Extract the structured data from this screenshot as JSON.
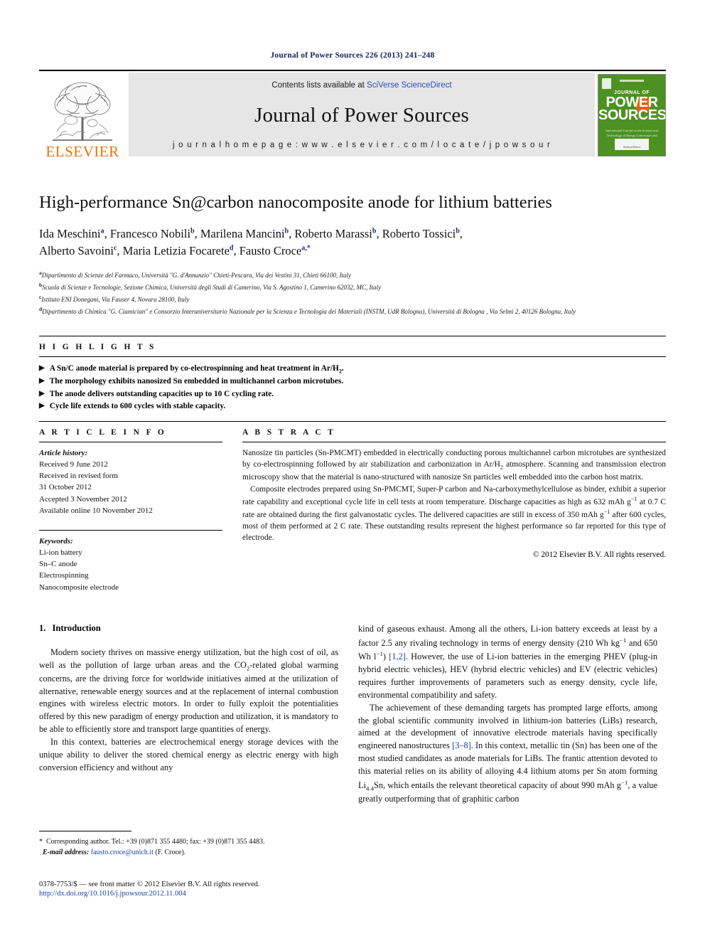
{
  "running_head": "Journal of Power Sources 226 (2013) 241–248",
  "masthead": {
    "publisher_name": "ELSEVIER",
    "banner_contents_prefix": "Contents lists available at ",
    "banner_contents_link": "SciVerse ScienceDirect",
    "journal_title": "Journal of Power Sources",
    "homepage": "j o u r n a l   h o m e p a g e :   w w w . e l s e v i e r . c o m / l o c a t e / j p o w s o u r",
    "cover": {
      "journal_of": "JOURNAL OF",
      "power": "POWER",
      "sources": "SOURCES",
      "subtitle": "International Journal on the Science and Technology of Energy Conversion and Electrochemical Systems",
      "footer_note": "Available online at",
      "footer_box": "ScienceDirect"
    },
    "colors": {
      "cover_green": "#4d9122",
      "cover_orange": "#e8600f",
      "elsevier_orange": "#e8730c",
      "link_blue": "#2a4bbd"
    }
  },
  "article": {
    "title": "High-performance Sn@carbon nanocomposite anode for lithium batteries",
    "authors_line1": "Ida Meschini ª, Francesco Nobili b, Marilena Mancini b, Roberto Marassi b, Roberto Tossici b,",
    "authors_line2": "Alberto Savoini c, Maria Letizia Focarete d, Fausto Croce a,*",
    "authors": [
      {
        "name": "Ida Meschini",
        "sup": "a"
      },
      {
        "name": "Francesco Nobili",
        "sup": "b"
      },
      {
        "name": "Marilena Mancini",
        "sup": "b"
      },
      {
        "name": "Roberto Marassi",
        "sup": "b"
      },
      {
        "name": "Roberto Tossici",
        "sup": "b"
      },
      {
        "name": "Alberto Savoini",
        "sup": "c"
      },
      {
        "name": "Maria Letizia Focarete",
        "sup": "d"
      },
      {
        "name": "Fausto Croce",
        "sup": "a,*"
      }
    ],
    "affiliations": [
      {
        "sup": "a",
        "text": "Dipartimento di Scienze del Farmaco, Università \"G. d'Annunzio\" Chieti-Pescara, Via dei Vestini 31, Chieti 66100, Italy"
      },
      {
        "sup": "b",
        "text": "Scuola di Scienze e Tecnologie, Sezione Chimica, Università degli Studi di Camerino, Via S. Agostino 1, Camerino 62032, MC, Italy"
      },
      {
        "sup": "c",
        "text": "Istituto ENI Donegani, Via Fauser 4, Novara 28100, Italy"
      },
      {
        "sup": "d",
        "text": "Dipartimento di Chimica \"G. Ciamician\" e Consorzio Interuniversitario Nazionale per la Scienza e Tecnologia dei Materiali (INSTM, UdR Bologna), Università di Bologna , Via Selmi 2, 40126 Bologna, Italy"
      }
    ]
  },
  "highlights": {
    "heading": "H I G H L I G H T S",
    "bullet_glyph": "▶",
    "items": [
      "A Sn/C anode material is prepared by co-electrospinning and heat treatment in Ar/H2.",
      "The morphology exhibits nanosized Sn embedded in multichannel carbon microtubes.",
      "The anode delivers outstanding capacities up to 10 C cycling rate.",
      "Cycle life extends to 600 cycles with stable capacity."
    ]
  },
  "article_info": {
    "heading": "A R T I C L E   I N F O",
    "history_label": "Article history:",
    "history": [
      "Received 9 June 2012",
      "Received in revised form",
      "31 October 2012",
      "Accepted 3 November 2012",
      "Available online 10 November 2012"
    ],
    "keywords_label": "Keywords:",
    "keywords": [
      "Li-ion battery",
      "Sn–C anode",
      "Electrospinning",
      "Nanocomposite electrode"
    ]
  },
  "abstract": {
    "heading": "A B S T R A C T",
    "paragraph1": "Nanosize tin particles (Sn-PMCMT) embedded in electrically conducting porous multichannel carbon microtubes are synthesized by co-electrospinning followed by air stabilization and carbonization in Ar/H2 atmosphere. Scanning and transmission electron microscopy show that the material is nano-structured with nanosize Sn particles well embedded into the carbon host matrix.",
    "paragraph2": "Composite electrodes prepared using Sn-PMCMT, Super-P carbon and Na-carboxymethylcellulose as binder, exhibit a superior rate capability and exceptional cycle life in cell tests at room temperature. Discharge capacities as high as 632 mAh g−1 at 0.7 C rate are obtained during the first galvanostatic cycles. The delivered capacities are still in excess of 350 mAh g−1 after 600 cycles, most of them performed at 2 C rate. These outstanding results represent the highest performance so far reported for this type of electrode.",
    "copyright": "© 2012 Elsevier B.V. All rights reserved."
  },
  "introduction": {
    "number": "1.",
    "heading": "Introduction",
    "left_p1": "Modern society thrives on massive energy utilization, but the high cost of oil, as well as the pollution of large urban areas and the CO2-related global warming concerns, are the driving force for worldwide initiatives aimed at the utilization of alternative, renewable energy sources and at the replacement of internal combustion engines with wireless electric motors. In order to fully exploit the potentialities offered by this new paradigm of energy production and utilization, it is mandatory to be able to efficiently store and transport large quantities of energy.",
    "left_p2": "In this context, batteries are electrochemical energy storage devices with the unique ability to deliver the stored chemical energy as electric energy with high conversion efficiency and without any",
    "right_p1_a": "kind of gaseous exhaust. Among all the others, Li-ion battery exceeds at least by a factor 2.5 any rivaling technology in terms of energy density (210 Wh kg−1 and 650 Wh l−1) ",
    "right_p1_cite": "[1,2]",
    "right_p1_b": ". However, the use of Li-ion batteries in the emerging PHEV (plug-in hybrid electric vehicles), HEV (hybrid electric vehicles) and EV (electric vehicles) requires further improvements of parameters such as energy density, cycle life, environmental compatibility and safety.",
    "right_p2_a": "The achievement of these demanding targets has prompted large efforts, among the global scientific community involved in lithium-ion batteries (LiBs) research, aimed at the development of innovative electrode materials having specifically engineered nanostructures ",
    "right_p2_cite": "[3–8]",
    "right_p2_b": ". In this context, metallic tin (Sn) has been one of the most studied candidates as anode materials for LiBs. The frantic attention devoted to this material relies on its ability of alloying 4.4 lithium atoms per Sn atom forming Li4.4Sn, which entails the relevant theoretical capacity of about 990 mAh g−1, a value greatly outperforming that of graphitic carbon"
  },
  "footnote": {
    "star": "*",
    "corresponding": "Corresponding author. Tel.: +39 (0)871 355 4480; fax: +39 (0)871 355 4483.",
    "email_label": "E-mail address:",
    "email": "fausto.croce@unich.it",
    "email_suffix": " (F. Croce)."
  },
  "footer": {
    "issn_line": "0378-7753/$ — see front matter © 2012 Elsevier B.V. All rights reserved.",
    "doi": "http://dx.doi.org/10.1016/j.jpowsour.2012.11.004"
  }
}
